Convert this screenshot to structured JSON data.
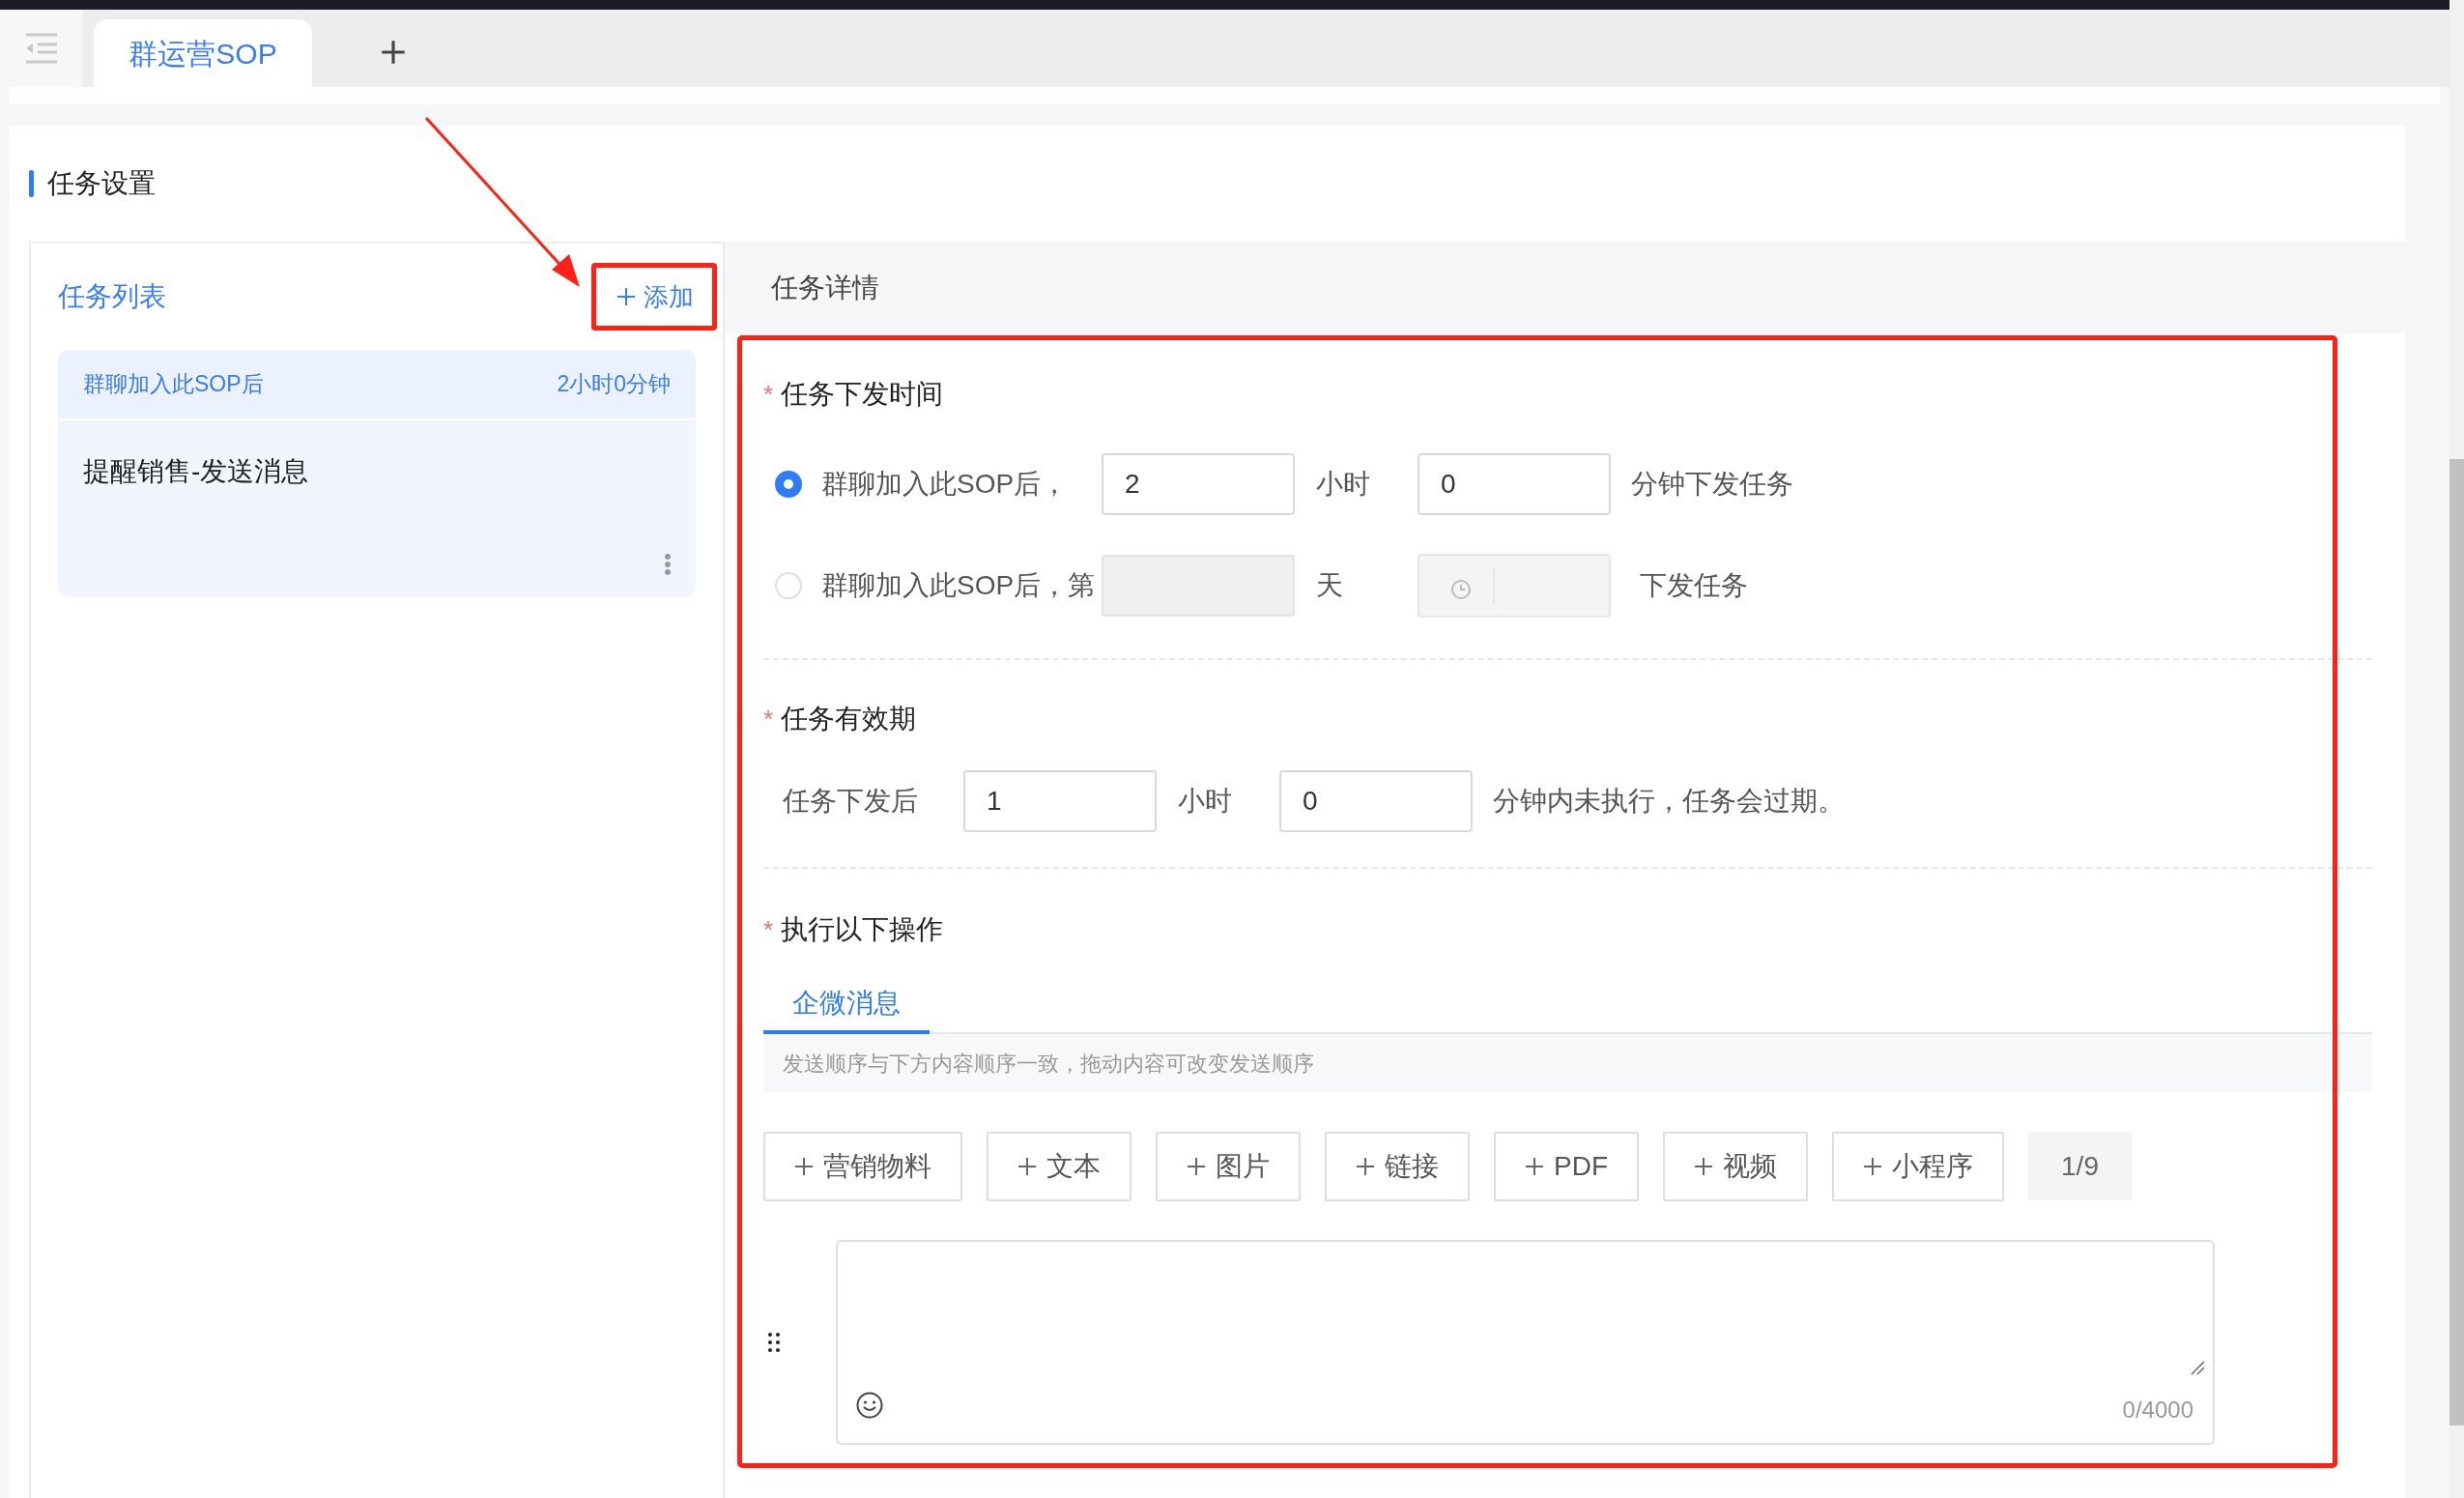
{
  "tab_bar": {
    "tabs": [
      {
        "label": "群运营SOP",
        "selected": true
      }
    ]
  },
  "section_title": "任务设置",
  "task_list": {
    "title": "任务列表",
    "add_button": "添加",
    "items": [
      {
        "trigger": "群聊加入此SOP后",
        "delay": "2小时0分钟",
        "name": "提醒销售-发送消息",
        "selected": true
      }
    ]
  },
  "detail": {
    "header": "任务详情",
    "send_time": {
      "required_mark": "*",
      "title": "任务下发时间",
      "options": [
        {
          "kind": "hours",
          "selected": true,
          "disabled": false,
          "prefix": "群聊加入此SOP后，",
          "hours": "2",
          "hours_unit": "小时",
          "minutes": "0",
          "suffix": "分钟下发任务"
        },
        {
          "kind": "day",
          "selected": false,
          "disabled": true,
          "prefix": "群聊加入此SOP后，第",
          "day_unit": "天",
          "suffix": "下发任务"
        }
      ]
    },
    "validity": {
      "required_mark": "*",
      "title": "任务有效期",
      "prefix": "任务下发后",
      "hours": "1",
      "hours_unit": "小时",
      "minutes": "0",
      "suffix": "分钟内未执行，任务会过期。"
    },
    "actions": {
      "required_mark": "*",
      "title": "执行以下操作",
      "tabs": [
        {
          "label": "企微消息",
          "selected": true
        }
      ],
      "hint": "发送顺序与下方内容顺序一致，拖动内容可改变发送顺序",
      "add_buttons": [
        "营销物料",
        "文本",
        "图片",
        "链接",
        "PDF",
        "视频",
        "小程序"
      ],
      "count": "1/9",
      "editor": {
        "counter": "0/4000"
      }
    }
  }
}
